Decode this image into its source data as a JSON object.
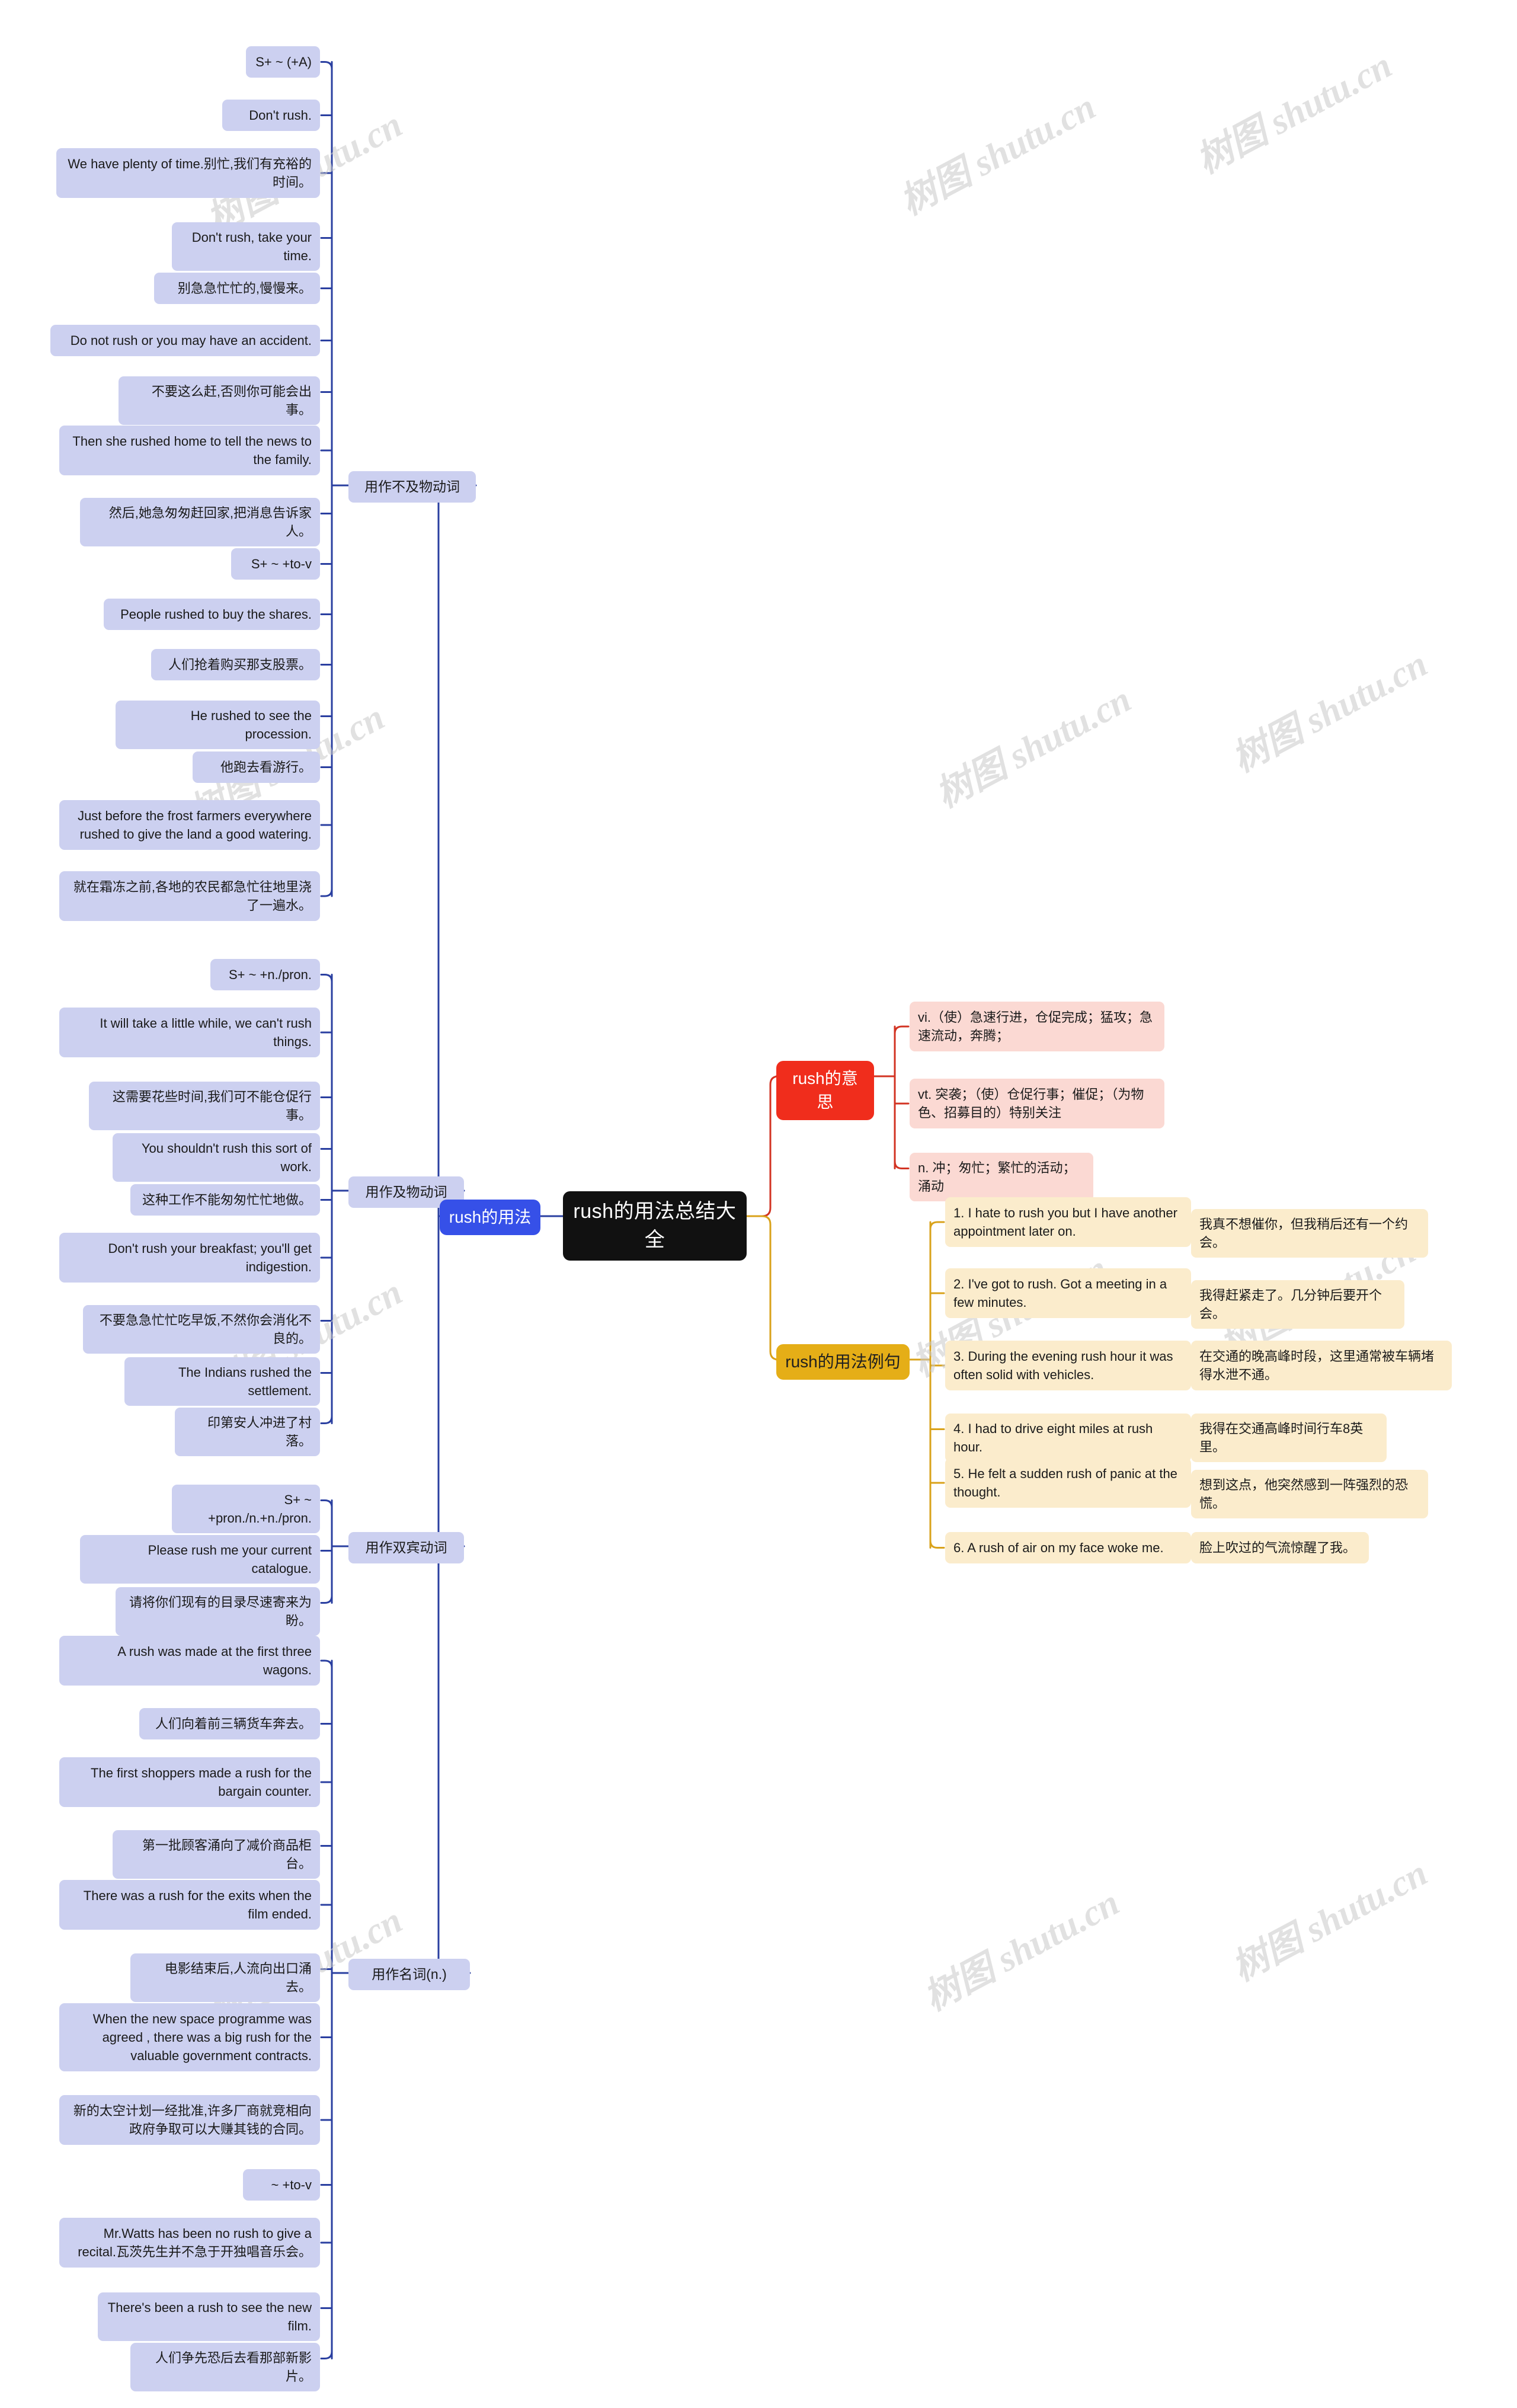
{
  "root": {
    "label": "rush的用法总结大全"
  },
  "branches": {
    "usage": {
      "label": "rush的用法",
      "color": "#3650e8"
    },
    "meaning": {
      "label": "rush的意思",
      "color": "#f02d1c"
    },
    "examples": {
      "label": "rush的用法例句",
      "color": "#e5ae17"
    }
  },
  "categories": {
    "intransitive": "用作不及物动词",
    "transitive": "用作及物动词",
    "ditransitive": "用作双宾动词",
    "noun": "用作名词(n.)"
  },
  "intransitive_items": [
    "S+ ~ (+A)",
    "Don't rush.",
    "We have plenty of time.别忙,我们有充裕的时间。",
    "Don't rush, take your time.",
    "别急急忙忙的,慢慢来。",
    "Do not rush or you may have an accident.",
    "不要这么赶,否则你可能会出事。",
    "Then she rushed home to tell the news to the family.",
    "然后,她急匆匆赶回家,把消息告诉家人。",
    "S+ ~ +to-v",
    "People rushed to buy the shares.",
    "人们抢着购买那支股票。",
    "He rushed to see the procession.",
    "他跑去看游行。",
    "Just before the frost farmers everywhere rushed to give the land a good watering.",
    "就在霜冻之前,各地的农民都急忙往地里浇了一遍水。"
  ],
  "transitive_items": [
    "S+ ~ +n./pron.",
    "It will take a little while, we can't rush things.",
    "这需要花些时间,我们可不能仓促行事。",
    "You shouldn't rush this sort of work.",
    "这种工作不能匆匆忙忙地做。",
    "Don't rush your breakfast; you'll get indigestion.",
    "不要急急忙忙吃早饭,不然你会消化不良的。",
    "The Indians rushed the settlement.",
    "印第安人冲进了村落。"
  ],
  "ditransitive_items": [
    "S+ ~ +pron./n.+n./pron.",
    "Please rush me your current catalogue.",
    "请将你们现有的目录尽速寄来为盼。"
  ],
  "noun_items": [
    "A rush was made at the first three wagons.",
    "人们向着前三辆货车奔去。",
    "The first shoppers made a rush for the bargain counter.",
    "第一批顾客涌向了减价商品柜台。",
    "There was a rush for the exits when the film ended.",
    "电影结束后,人流向出口涌去。",
    "When the new space programme was agreed , there was a big rush for the valuable government contracts.",
    "新的太空计划一经批准,许多厂商就竞相向政府争取可以大赚其钱的合同。",
    "~ +to-v",
    "Mr.Watts has been no rush to give a recital.瓦茨先生并不急于开独唱音乐会。",
    "There's been a rush to see the new film.",
    "人们争先恐后去看那部新影片。"
  ],
  "meaning_items": [
    "vi.（使）急速行进，仓促完成；猛攻；急速流动，奔腾；",
    "vt. 突袭；（使）仓促行事；催促；（为物色、招募目的）特别关注",
    "n. 冲；匆忙；繁忙的活动；涌动"
  ],
  "example_sentences": [
    {
      "en": "1. I hate to rush you but I have another appointment later on.",
      "zh": "我真不想催你，但我稍后还有一个约会。"
    },
    {
      "en": "2. I've got to rush. Got a meeting in a few minutes.",
      "zh": "我得赶紧走了。几分钟后要开个会。"
    },
    {
      "en": "3. During the evening rush hour it was often solid with vehicles.",
      "zh": "在交通的晚高峰时段，这里通常被车辆堵得水泄不通。"
    },
    {
      "en": "4. I had to drive eight miles at rush hour.",
      "zh": "我得在交通高峰时间行车8英里。"
    },
    {
      "en": "5. He felt a sudden rush of panic at the thought.",
      "zh": "想到这点，他突然感到一阵强烈的恐慌。"
    },
    {
      "en": "6. A rush of air on my face woke me.",
      "zh": "脸上吹过的气流惊醒了我。"
    }
  ],
  "watermarks": [
    "树图 shutu.cn",
    "树图 shutu.cn",
    "树图 shutu.cn",
    "树图 shutu.cn",
    "树图 shutu.cn",
    "树图 shutu.cn",
    "树图 shutu.cn",
    "树图 shutu.cn",
    "树图 shutu.cn"
  ]
}
